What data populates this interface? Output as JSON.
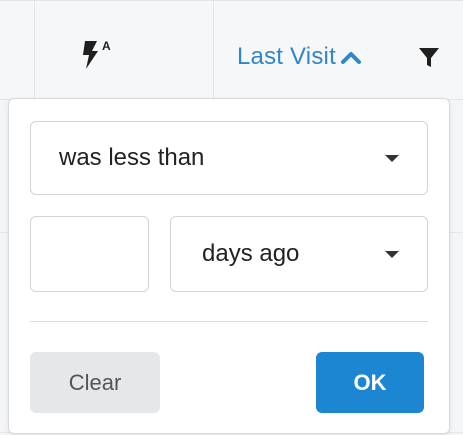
{
  "header": {
    "flash_icon": "flash-auto-icon",
    "flash_sup": "A",
    "sort_column_label": "Last Visit",
    "sort_icon": "chevron-up-icon",
    "filter_icon": "funnel-icon",
    "accent_color": "#2f87c8"
  },
  "filter_panel": {
    "operator": {
      "selected": "was less than"
    },
    "amount": {
      "value": ""
    },
    "unit": {
      "selected": "days ago"
    },
    "clear_label": "Clear",
    "ok_label": "OK",
    "ok_color": "#1d86d3"
  }
}
